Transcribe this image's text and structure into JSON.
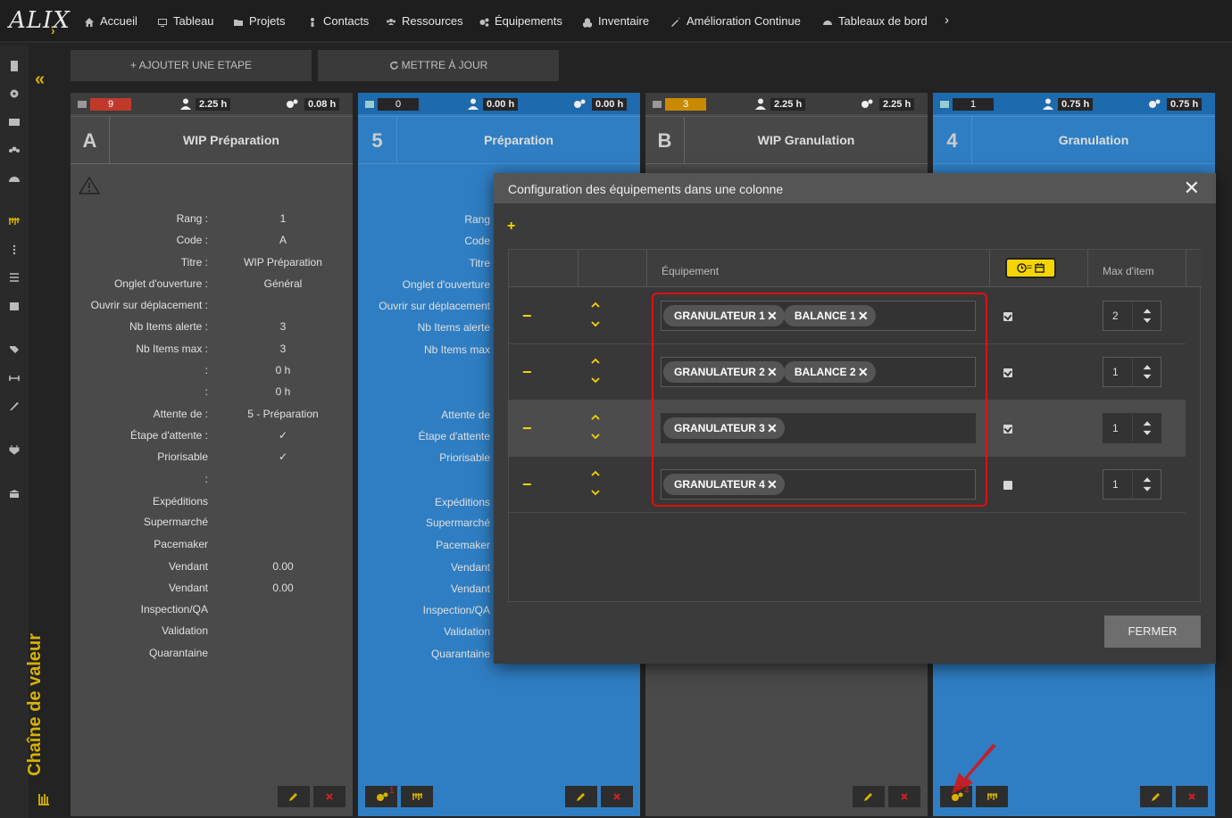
{
  "topbar": {
    "logo": "ALIX",
    "nav": [
      {
        "label": "Accueil",
        "icon": "home-icon"
      },
      {
        "label": "Tableau",
        "icon": "monitor-icon"
      },
      {
        "label": "Projets",
        "icon": "folder-icon"
      },
      {
        "label": "Contacts",
        "icon": "person-icon"
      },
      {
        "label": "Ressources",
        "icon": "users-icon"
      },
      {
        "label": "Équipements",
        "icon": "gears-icon"
      },
      {
        "label": "Inventaire",
        "icon": "cubes-icon"
      },
      {
        "label": "Amélioration Continue",
        "icon": "magic-icon"
      },
      {
        "label": "Tableaux de bord",
        "icon": "dashboard-icon"
      }
    ],
    "more_icon": "chevron-right-icon"
  },
  "side": {
    "title": "Chaîne de valeur",
    "collapse_icon": "double-chevron-left-icon"
  },
  "toolbar": {
    "add_step": "+ AJOUTER UNE ETAPE",
    "update": "METTRE À JOUR"
  },
  "columns": [
    {
      "badge": "9",
      "badge_color": "#c0392b",
      "time_person": "2.25 h",
      "time_equip": "0.08 h",
      "letter": "A",
      "name": "WIP Préparation",
      "theme": "gray"
    },
    {
      "badge": "0",
      "badge_color": "#262626",
      "time_person": "0.00 h",
      "time_equip": "0.00 h",
      "letter": "5",
      "name": "Préparation",
      "theme": "blue"
    },
    {
      "badge": "3",
      "badge_color": "#c98a00",
      "time_person": "2.25 h",
      "time_equip": "2.25 h",
      "letter": "B",
      "name": "WIP Granulation",
      "theme": "gray"
    },
    {
      "badge": "1",
      "badge_color": "#262626",
      "time_person": "0.75 h",
      "time_equip": "0.75 h",
      "letter": "4",
      "name": "Granulation",
      "theme": "blue"
    }
  ],
  "props_labels": [
    "Rang :",
    "Code :",
    "Titre :",
    "Onglet d'ouverture :",
    "Ouvrir sur déplacement :",
    "Nb Items alerte :",
    "Nb Items max :",
    ":",
    ":",
    "Attente de :",
    "Étape d'attente :",
    "Priorisable",
    ":",
    "Expéditions",
    "Supermarché",
    "Pacemaker",
    "Vendant",
    "Vendant",
    "Inspection/QA",
    "Validation",
    "Quarantaine"
  ],
  "props_labels_blue": [
    "Rang",
    "Code",
    "Titre",
    "Onglet d'ouverture",
    "Ouvrir sur déplacement",
    "Nb Items alerte",
    "Nb Items max",
    "",
    "",
    "Attente de",
    "Étape d'attente",
    "Priorisable",
    "",
    "Expéditions",
    "Supermarché",
    "Pacemaker",
    "Vendant",
    "Vendant",
    "Inspection/QA",
    "Validation",
    "Quarantaine"
  ],
  "props_values_A": [
    "1",
    "A",
    "WIP Préparation",
    "Général",
    "",
    "3",
    "3",
    "0 h",
    "0 h",
    "5 - Préparation",
    "✓",
    "✓",
    "",
    "",
    "",
    "",
    "0.00",
    "0.00",
    "",
    "",
    ""
  ],
  "col4_footer_count": "4",
  "col2_footer_count": "1",
  "modal": {
    "title": "Configuration des équipements dans une colonne",
    "add": "+",
    "col_equipment": "Équipement",
    "col_max": "Max d'item",
    "clock_header": "= ",
    "close_button": "FERMER",
    "rows": [
      {
        "chips": [
          "GRANULATEUR 1",
          "BALANCE 1"
        ],
        "checked": true,
        "max": "2"
      },
      {
        "chips": [
          "GRANULATEUR 2",
          "BALANCE 2"
        ],
        "checked": true,
        "max": "1"
      },
      {
        "chips": [
          "GRANULATEUR 3"
        ],
        "checked": true,
        "max": "1"
      },
      {
        "chips": [
          "GRANULATEUR 4"
        ],
        "checked": false,
        "max": "1"
      }
    ]
  }
}
